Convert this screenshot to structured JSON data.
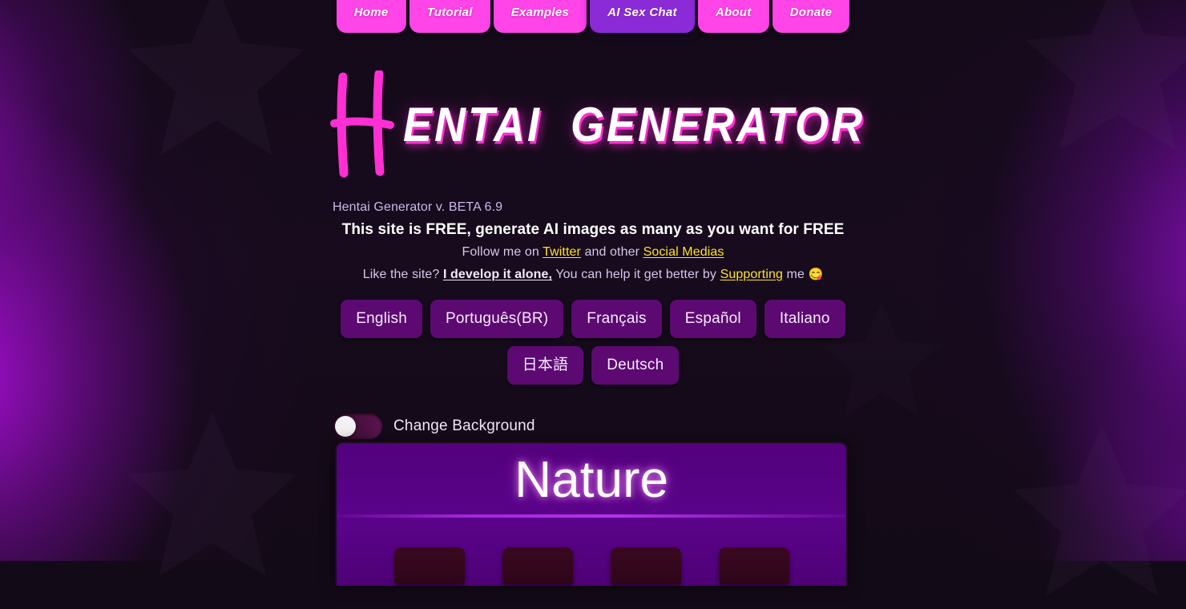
{
  "theme": {
    "nav_pink": "#ff44e8",
    "nav_accent_purple": "#8b2bd8",
    "lang_purple": "#5c0a72",
    "card_purple": "#550180",
    "link_yellow": "#ffe224",
    "page_bg": "#130a18"
  },
  "nav": {
    "items": [
      {
        "label": "Home",
        "active": false
      },
      {
        "label": "Tutorial",
        "active": false
      },
      {
        "label": "Examples",
        "active": false
      },
      {
        "label": "AI Sex Chat",
        "active": true
      },
      {
        "label": "About",
        "active": false
      },
      {
        "label": "Donate",
        "active": false
      }
    ]
  },
  "logo": {
    "initial": "H",
    "text": "ENTAI  GENERATOR",
    "full_title": "Hentai Generator"
  },
  "info": {
    "version": "Hentai Generator v. BETA 6.9",
    "free_line": "This site is FREE, generate AI images as many as you want for FREE",
    "follow_prefix": "Follow me on ",
    "follow_link_1": "Twitter",
    "follow_middle": " and other ",
    "follow_link_2": "Social Medias",
    "support_prefix": "Like the site? ",
    "support_link_1": "I develop it alone,",
    "support_middle": " You can help it get better by ",
    "support_link_2": "Supporting",
    "support_suffix": " me ",
    "emoji": "😋"
  },
  "languages": {
    "items": [
      {
        "label": "English"
      },
      {
        "label": "Português(BR)"
      },
      {
        "label": "Français"
      },
      {
        "label": "Español"
      },
      {
        "label": "Italiano"
      },
      {
        "label": "日本語"
      },
      {
        "label": "Deutsch"
      }
    ]
  },
  "background_toggle": {
    "label": "Change Background",
    "state": "off"
  },
  "nature_card": {
    "title": "Nature",
    "buttons": [
      {
        "label": ""
      },
      {
        "label": ""
      },
      {
        "label": ""
      },
      {
        "label": ""
      }
    ]
  }
}
